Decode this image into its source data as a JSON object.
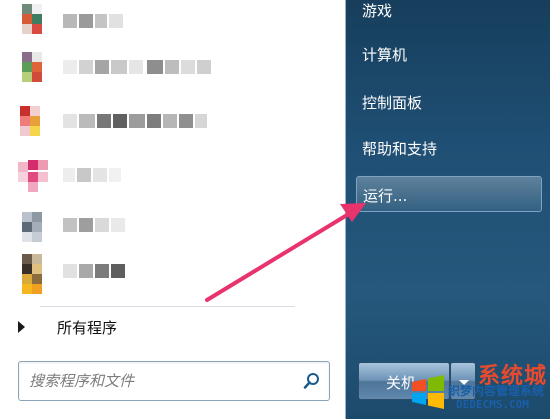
{
  "start_menu": {
    "all_programs_label": "所有程序",
    "search": {
      "placeholder": "搜索程序和文件",
      "value": ""
    },
    "right_items": [
      {
        "label": "游戏"
      },
      {
        "label": "计算机"
      },
      {
        "label": "控制面板"
      },
      {
        "label": "帮助和支持"
      },
      {
        "label": "运行..."
      }
    ],
    "shutdown_label": "关机",
    "highlighted_item": "运行..."
  },
  "programs": [
    {
      "icon": "pixelated-icon",
      "blurred": true
    },
    {
      "icon": "pixelated-icon",
      "blurred": true
    },
    {
      "icon": "pixelated-icon",
      "blurred": true
    },
    {
      "icon": "pixelated-icon",
      "blurred": true
    },
    {
      "icon": "pixelated-icon",
      "blurred": true
    },
    {
      "icon": "pixelated-icon",
      "blurred": true
    }
  ],
  "watermark": {
    "title": "系统城",
    "subtitle": "织梦内容管理系统",
    "site": "DEDECMS.COM"
  },
  "colors": {
    "right_panel": "#1f4f74",
    "annotation_arrow": "#e8336d",
    "watermark_red": "#e84a2e",
    "watermark_blue": "#1a5fa8"
  }
}
